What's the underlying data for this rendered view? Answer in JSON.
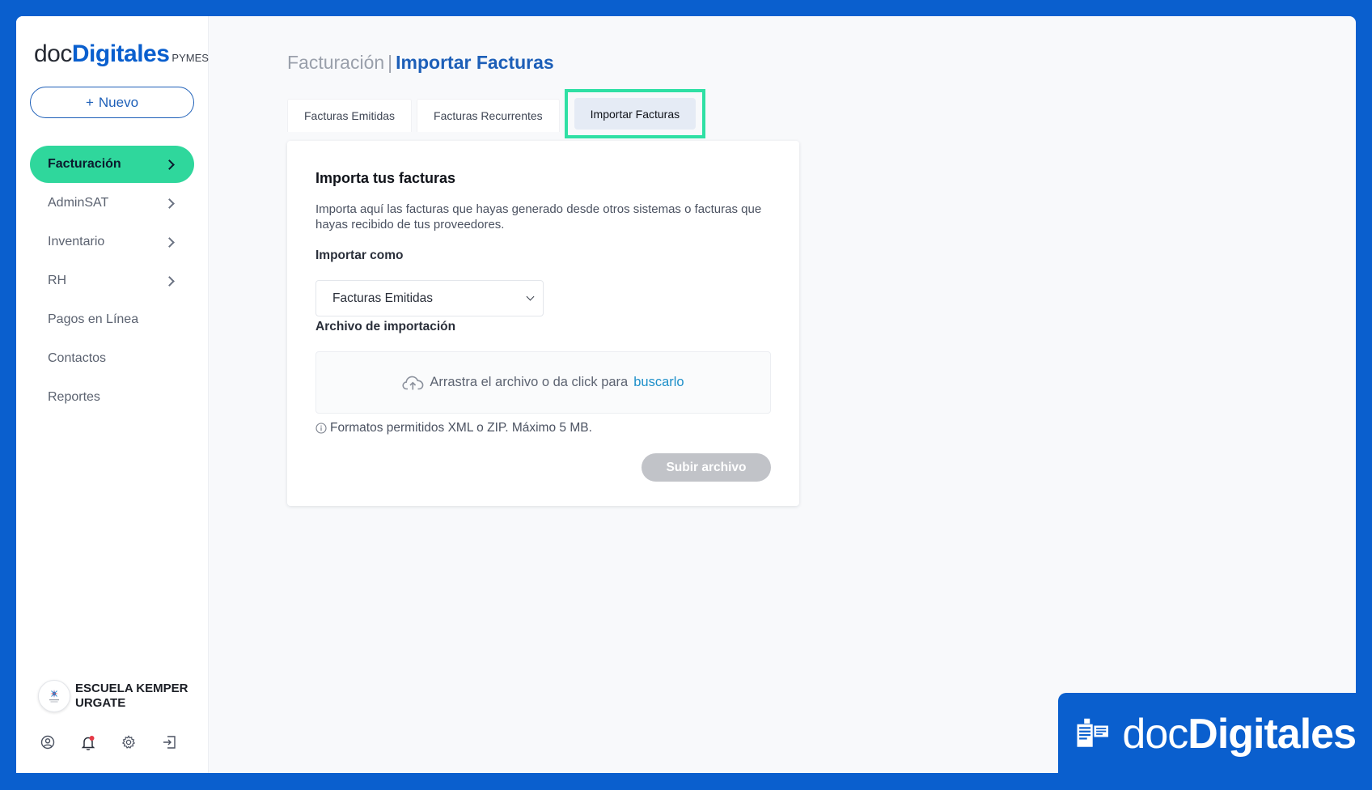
{
  "logo": {
    "doc": "doc",
    "digitales": "Digitales",
    "pymes": "PYMES"
  },
  "sidebar": {
    "new_button": {
      "plus": "+",
      "label": "Nuevo"
    },
    "items": [
      {
        "label": "Facturación",
        "has_chevron": true,
        "active": true
      },
      {
        "label": "AdminSAT",
        "has_chevron": true,
        "active": false
      },
      {
        "label": "Inventario",
        "has_chevron": true,
        "active": false
      },
      {
        "label": "RH",
        "has_chevron": true,
        "active": false
      },
      {
        "label": "Pagos en Línea",
        "has_chevron": false,
        "active": false
      },
      {
        "label": "Contactos",
        "has_chevron": false,
        "active": false
      },
      {
        "label": "Reportes",
        "has_chevron": false,
        "active": false
      }
    ],
    "user": {
      "name": "ESCUELA KEMPER URGATE"
    },
    "footer_icons": [
      "user-icon",
      "bell-icon",
      "gear-icon",
      "logout-icon"
    ]
  },
  "header": {
    "section": "Facturación",
    "separator": "|",
    "page": "Importar Facturas"
  },
  "tabs": [
    {
      "label": "Facturas Emitidas",
      "active": false
    },
    {
      "label": "Facturas Recurrentes",
      "active": false
    },
    {
      "label": "Importar Facturas",
      "active": true
    }
  ],
  "card": {
    "title": "Importa tus facturas",
    "description": "Importa aquí las facturas que hayas generado desde otros sistemas o facturas que hayas recibido de tus proveedores.",
    "import_as_label": "Importar como",
    "import_as_value": "Facturas Emitidas",
    "file_label": "Archivo de importación",
    "drop_text": "Arrastra el archivo o da click para",
    "drop_link": "buscarlo",
    "hint": "Formatos permitidos XML o ZIP. Máximo 5 MB.",
    "upload_button": "Subir archivo"
  },
  "brand_badge": {
    "doc": "doc",
    "digitales": "Digitales"
  },
  "colors": {
    "frame_blue": "#0a5fce",
    "accent_green": "#2fd79c",
    "highlight_green": "#2fe0a4",
    "link_blue": "#1d5fb8",
    "disabled_button": "#c1c3c8"
  }
}
